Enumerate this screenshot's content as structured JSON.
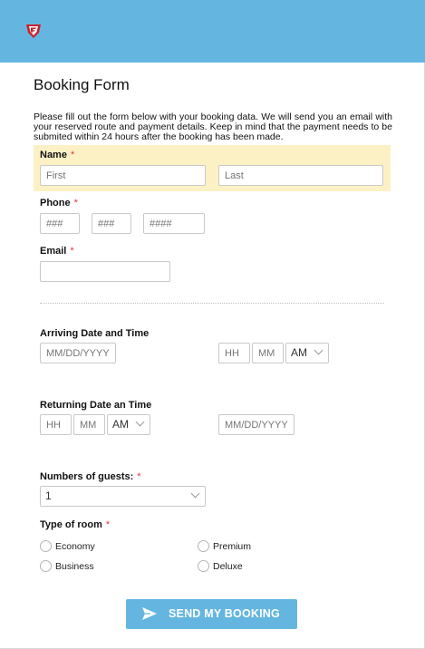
{
  "header": {
    "logo_icon": "shield-logo-icon",
    "bg_color": "#64b6e0"
  },
  "form": {
    "title": "Booking Form",
    "intro": "Please fill out the form below with your booking data. We will send you an email with your reserved route and payment details. Keep in mind that the payment needs to be submited within 24 hours after the booking has been made.",
    "required_mark": "*",
    "name": {
      "label": "Name",
      "first_placeholder": "First",
      "last_placeholder": "Last"
    },
    "phone": {
      "label": "Phone",
      "area_placeholder": "###",
      "prefix_placeholder": "###",
      "line_placeholder": "####"
    },
    "email": {
      "label": "Email",
      "value": ""
    },
    "arriving": {
      "label": "Arriving Date and Time",
      "date_placeholder": "MM/DD/YYYY",
      "hour_placeholder": "HH",
      "minute_placeholder": "MM",
      "ampm": "AM"
    },
    "returning": {
      "label": "Returning Date an Time",
      "hour_placeholder": "HH",
      "minute_placeholder": "MM",
      "ampm": "AM",
      "date_placeholder": "MM/DD/YYYY"
    },
    "guests": {
      "label": "Numbers of guests:",
      "value": "1"
    },
    "room": {
      "label": "Type of room",
      "options": [
        "Economy",
        "Premium",
        "Business",
        "Deluxe"
      ]
    },
    "submit": {
      "label": "SEND MY BOOKING",
      "icon": "paper-plane-icon",
      "color": "#64b6e0"
    }
  }
}
